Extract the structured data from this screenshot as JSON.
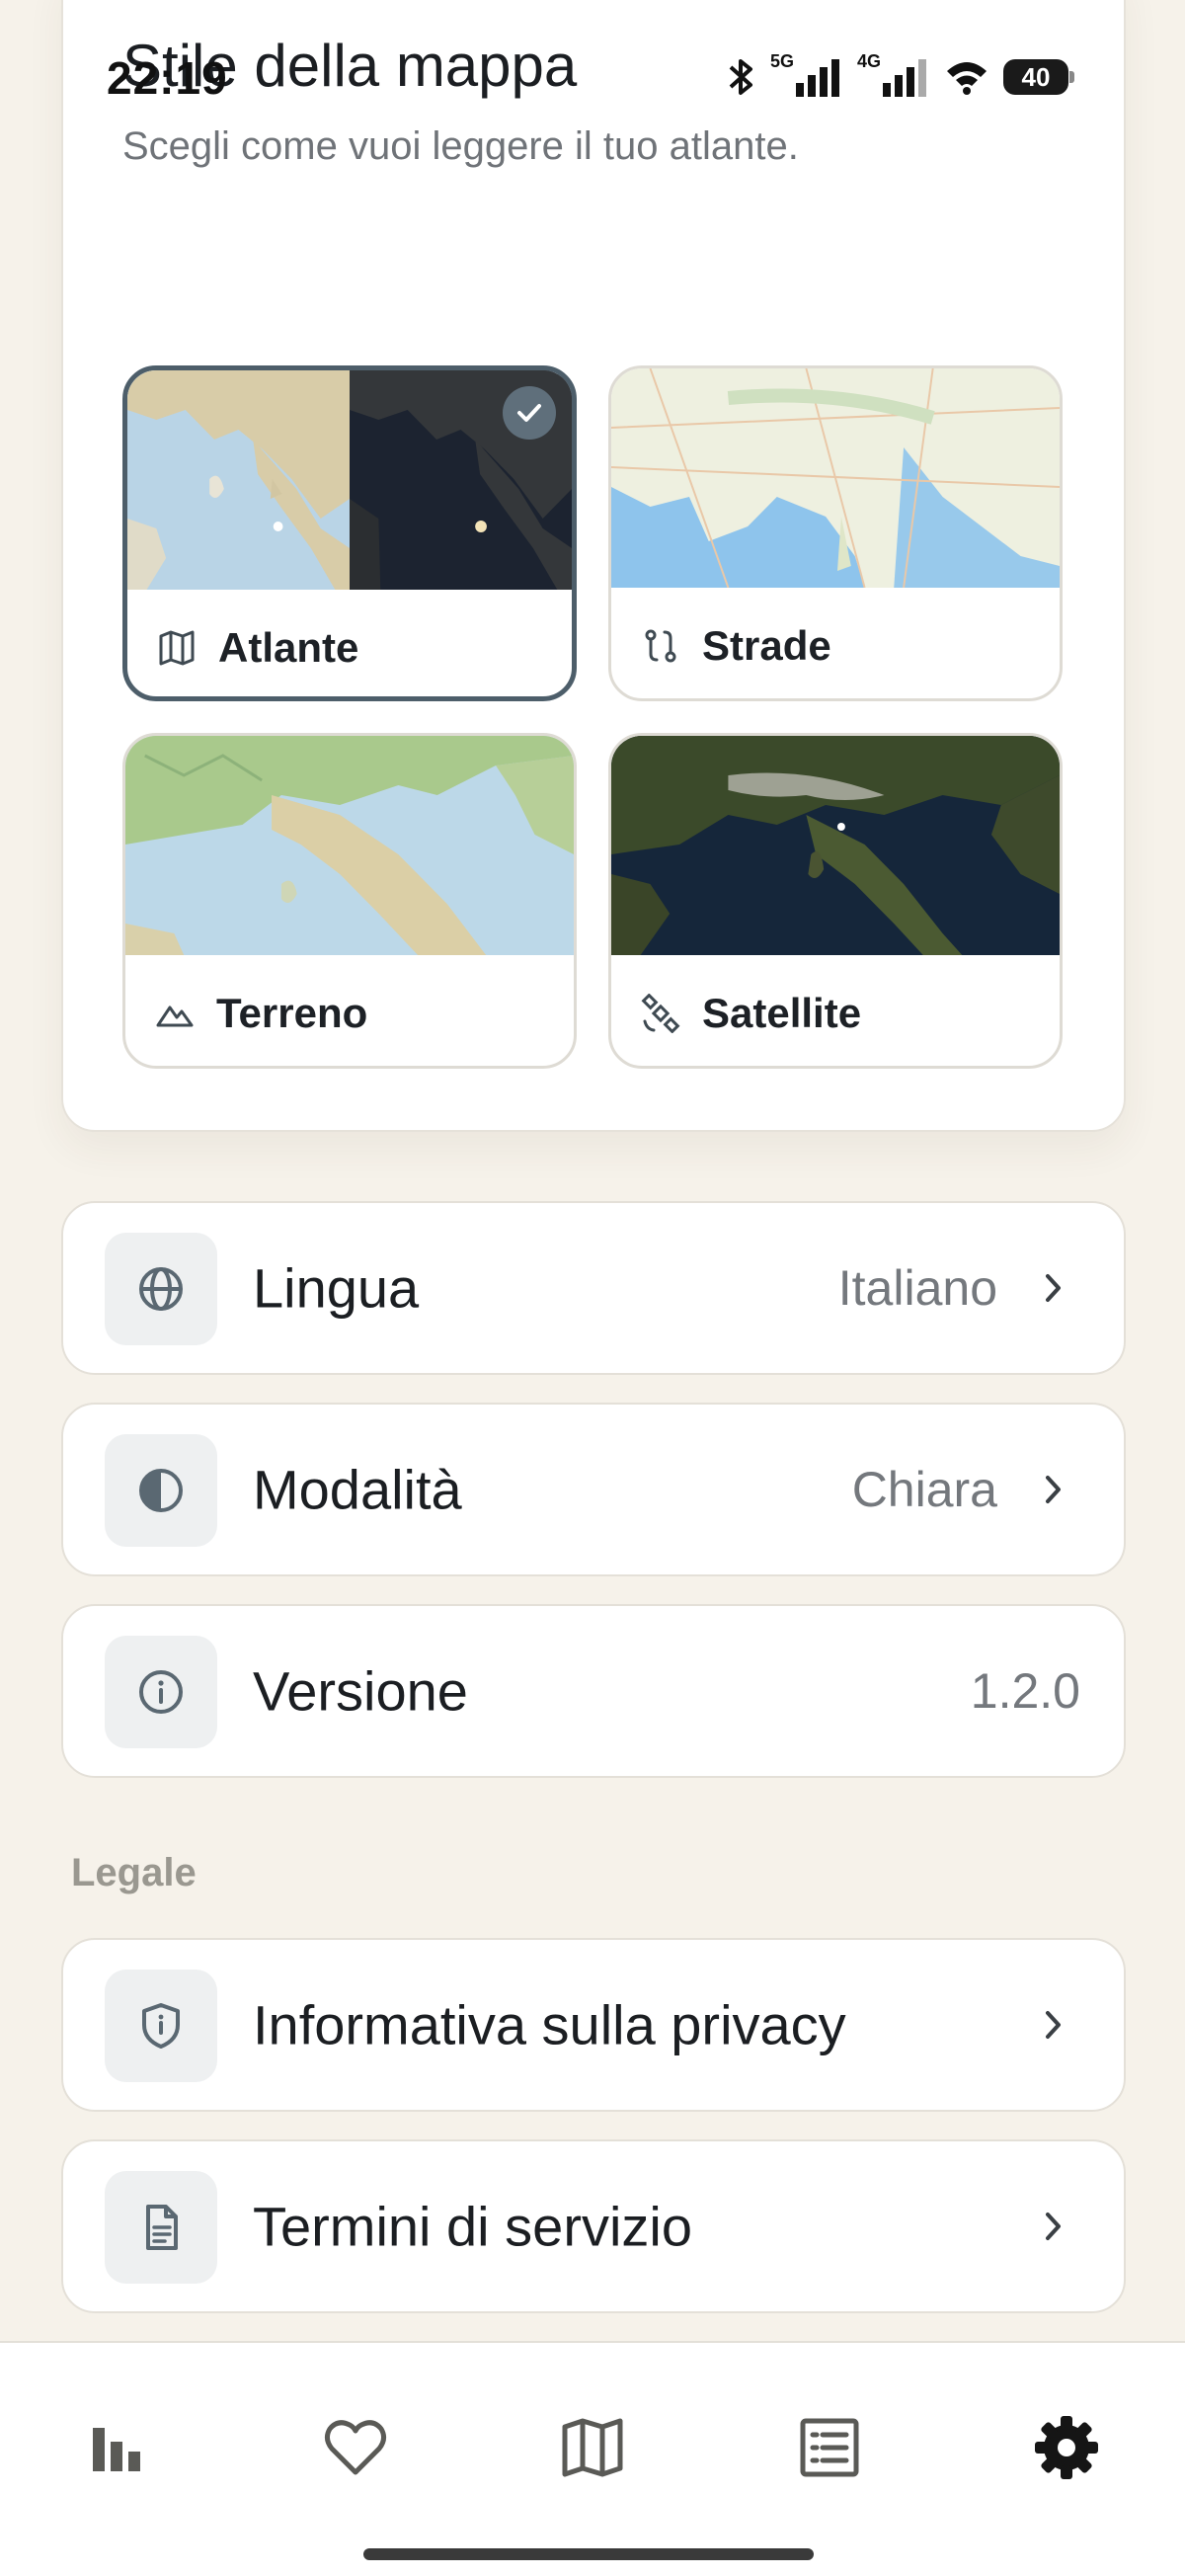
{
  "status_bar": {
    "time": "22:19",
    "signal1": "5G",
    "signal2": "4G",
    "battery": "40"
  },
  "map_style": {
    "title": "Stile della mappa",
    "subtitle": "Scegli come vuoi leggere il tuo atlante.",
    "options": [
      {
        "label": "Atlante",
        "icon": "map-icon",
        "selected": true
      },
      {
        "label": "Strade",
        "icon": "route-icon",
        "selected": false
      },
      {
        "label": "Terreno",
        "icon": "mountain-icon",
        "selected": false
      },
      {
        "label": "Satellite",
        "icon": "satellite-icon",
        "selected": false
      }
    ]
  },
  "settings": {
    "language": {
      "title": "Lingua",
      "value": "Italiano",
      "icon": "globe-icon"
    },
    "mode": {
      "title": "Modalità",
      "value": "Chiara",
      "icon": "contrast-icon"
    },
    "version": {
      "title": "Versione",
      "value": "1.2.0",
      "icon": "info-icon"
    }
  },
  "legal": {
    "section_label": "Legale",
    "privacy": {
      "title": "Informativa sulla privacy",
      "icon": "shield-icon"
    },
    "terms": {
      "title": "Termini di servizio",
      "icon": "document-icon"
    }
  },
  "bottom_nav": {
    "items": [
      {
        "icon": "bar-chart-icon",
        "active": false
      },
      {
        "icon": "heart-icon",
        "active": false
      },
      {
        "icon": "map-icon",
        "active": false
      },
      {
        "icon": "list-icon",
        "active": false
      },
      {
        "icon": "gear-icon",
        "active": true
      }
    ]
  },
  "colors": {
    "background": "#f6f2ea",
    "card": "#ffffff",
    "selected_border": "#4d5e6a",
    "text_primary": "#1b1e22",
    "text_secondary": "#74787d",
    "icon": "#5a6872"
  }
}
